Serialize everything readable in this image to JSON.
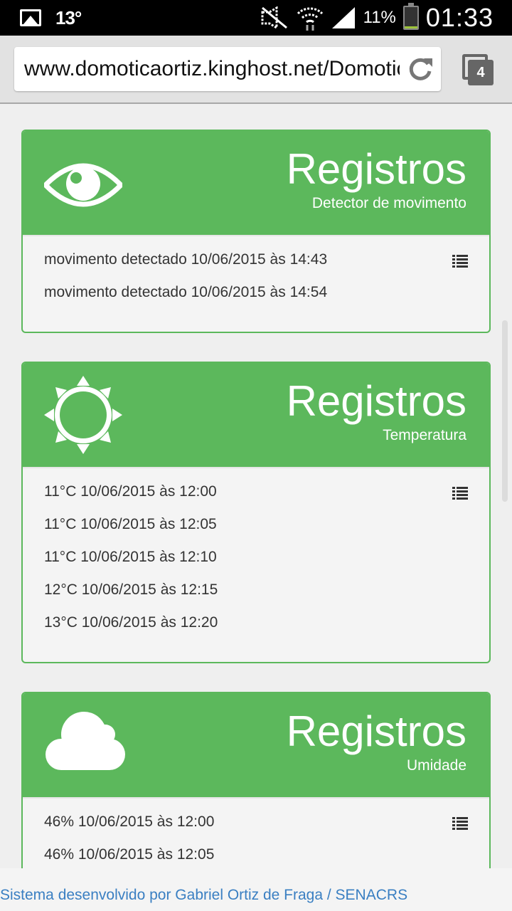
{
  "status_bar": {
    "temperature": "13°",
    "battery_percent": "11%",
    "battery_level": 0.11,
    "time": "01:33",
    "icons": [
      "gallery-icon",
      "mute-icon",
      "wifi-icon",
      "signal-icon",
      "battery-icon"
    ]
  },
  "browser": {
    "url": "www.domoticaortiz.kinghost.net/Domotica",
    "tab_count": "4"
  },
  "panels": [
    {
      "icon": "eye-icon",
      "title": "Registros",
      "subtitle": "Detector de movimento",
      "entries": [
        "movimento detectado 10/06/2015 às 14:43",
        "movimento detectado 10/06/2015 às 14:54"
      ]
    },
    {
      "icon": "sun-icon",
      "title": "Registros",
      "subtitle": "Temperatura",
      "entries": [
        "11°C 10/06/2015 às 12:00",
        "11°C 10/06/2015 às 12:05",
        "11°C 10/06/2015 às 12:10",
        "12°C 10/06/2015 às 12:15",
        "13°C 10/06/2015 às 12:20"
      ]
    },
    {
      "icon": "cloud-icon",
      "title": "Registros",
      "subtitle": "Umidade",
      "entries": [
        "46% 10/06/2015 às 12:00",
        "46% 10/06/2015 às 12:05"
      ]
    }
  ],
  "footer": {
    "text": "Sistema desenvolvido por Gabriel Ortiz de Fraga / SENACRS"
  },
  "colors": {
    "panel_green": "#5cb85c",
    "link_blue": "#3a7fc2"
  }
}
